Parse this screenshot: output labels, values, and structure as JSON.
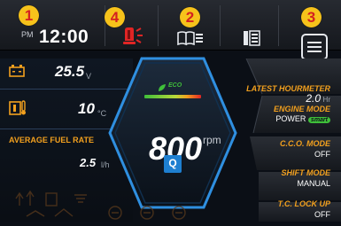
{
  "header": {
    "time_suffix": "PM",
    "time": "12:00",
    "badges": [
      "1",
      "4",
      "2",
      "3"
    ],
    "icons": [
      "alarm-light-icon",
      "manual-book-icon",
      "display-mode-icon",
      "menu-icon"
    ]
  },
  "left_panel": {
    "battery_value": "25.5",
    "battery_unit": "V",
    "coolant_value": "10",
    "coolant_unit": "°C",
    "fuel_rate_label": "AVERAGE FUEL RATE",
    "fuel_rate_value": "2.5",
    "fuel_rate_unit": "l/h"
  },
  "center": {
    "eco_label": "ECO",
    "rpm_value": "800",
    "rpm_unit": "rpm",
    "mode_letter": "Q"
  },
  "right_panel": {
    "hourmeter_label": "LATEST HOURMETER",
    "hourmeter_value": "2.0",
    "hourmeter_unit": "Hr",
    "engine_mode_label": "ENGINE MODE",
    "engine_mode_value": "POWER",
    "engine_mode_badge": "smart",
    "cco_label": "C.C.O. MODE",
    "cco_value": "OFF",
    "shift_label": "SHIFT MODE",
    "shift_value": "MANUAL",
    "tc_label": "T.C. LOCK UP",
    "tc_value": "OFF"
  },
  "colors": {
    "accent_orange": "#f2a01e",
    "badge_yellow": "#f6c21b",
    "badge_text_red": "#d42020",
    "alarm_red": "#e02525",
    "eco_green": "#3fbf3a",
    "hex_border": "#2f8fe0"
  }
}
